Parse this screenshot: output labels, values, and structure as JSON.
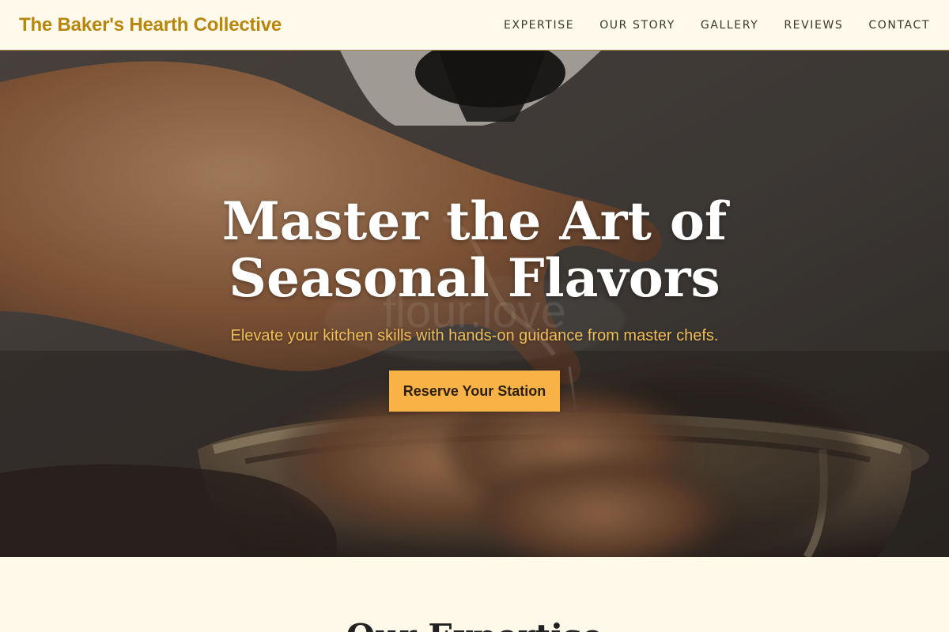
{
  "header": {
    "brand": "The Baker's Hearth Collective",
    "nav": [
      "EXPERTISE",
      "OUR STORY",
      "GALLERY",
      "REVIEWS",
      "CONTACT"
    ]
  },
  "hero": {
    "title_line1": "Master the Art of",
    "title_line2": "Seasonal Flavors",
    "subtitle": "Elevate your kitchen skills with hands-on guidance from master chefs.",
    "cta": "Reserve Your Station",
    "mug_text": "flour.love"
  },
  "section": {
    "title": "Our Expertise"
  },
  "colors": {
    "brand": "#b8860b",
    "nav_bg": "#fffaeb",
    "accent": "#f8b246",
    "subtitle": "#f0bd58"
  }
}
